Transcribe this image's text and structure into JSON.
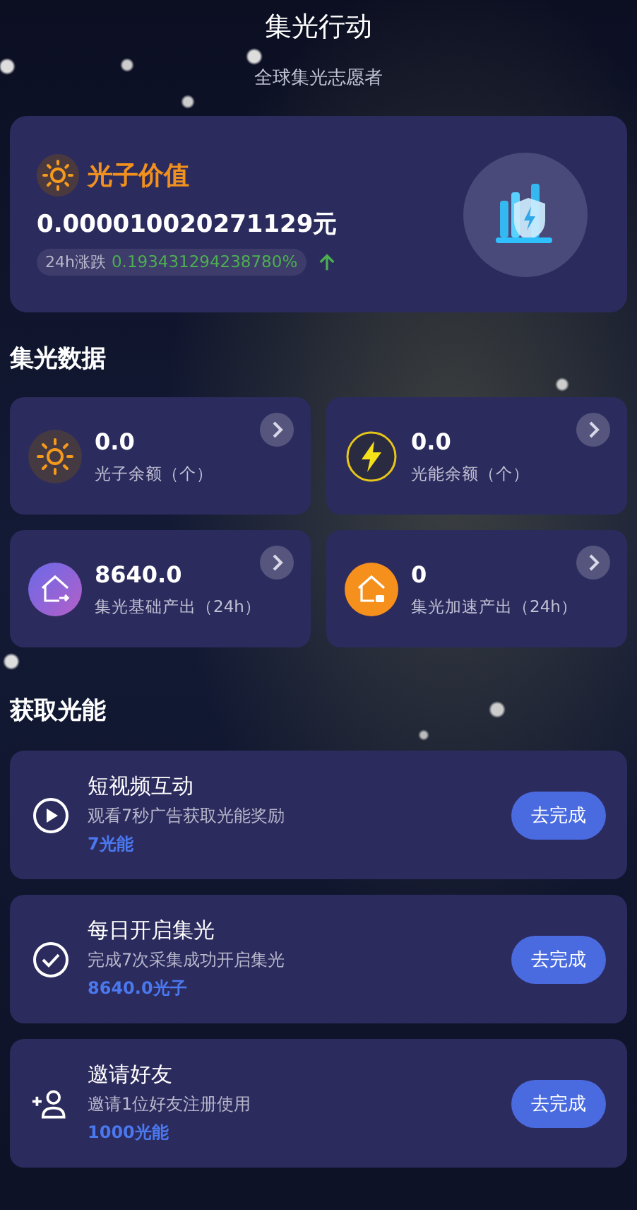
{
  "header": {
    "title": "集光行动",
    "subtitle": "全球集光志愿者"
  },
  "value_card": {
    "title": "光子价值",
    "price": "0.000010020271129元",
    "change_label": "24h涨跌",
    "change_value": "0.193431294238780%",
    "rising": true
  },
  "stats_section": {
    "title": "集光数据",
    "items": [
      {
        "kind": "sun",
        "value": "0.0",
        "label": "光子余额（个）"
      },
      {
        "kind": "bolt",
        "value": "0.0",
        "label": "光能余额（个）"
      },
      {
        "kind": "house-base",
        "value": "8640.0",
        "label": "集光基础产出（24h）"
      },
      {
        "kind": "house-boost",
        "value": "0",
        "label": "集光加速产出（24h）"
      }
    ]
  },
  "tasks_section": {
    "title": "获取光能",
    "items": [
      {
        "kind": "video",
        "title": "短视频互动",
        "description": "观看7秒广告获取光能奖励",
        "reward": "7光能",
        "button": "去完成"
      },
      {
        "kind": "check",
        "title": "每日开启集光",
        "description": "完成7次采集成功开启集光",
        "reward": "8640.0光子",
        "button": "去完成"
      },
      {
        "kind": "invite",
        "title": "邀请好友",
        "description": "邀请1位好友注册使用",
        "reward": "1000光能",
        "button": "去完成"
      }
    ]
  }
}
